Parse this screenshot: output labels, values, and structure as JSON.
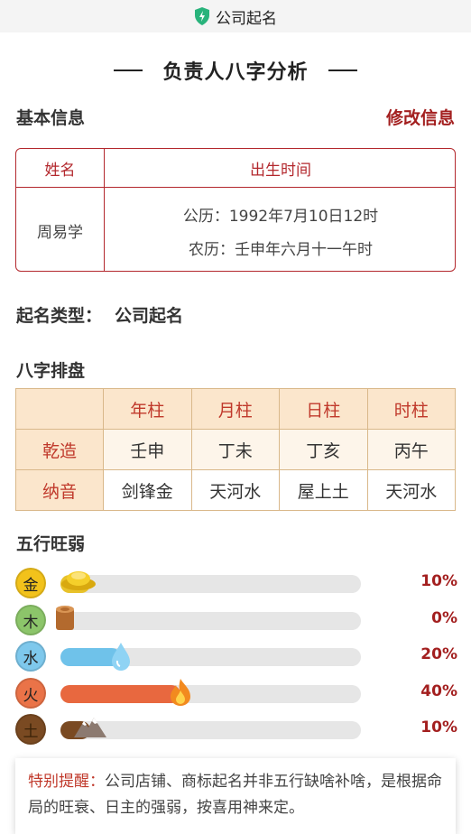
{
  "topbar": {
    "title": "公司起名",
    "icon": "shield-bolt-icon",
    "accent": "#28b37b"
  },
  "page": {
    "title": "负责人八字分析"
  },
  "basic_info": {
    "section_title": "基本信息",
    "edit_label": "修改信息",
    "headers": {
      "name": "姓名",
      "birth": "出生时间"
    },
    "name": "周易学",
    "solar": "公历：1992年7月10日12时",
    "lunar": "农历：壬申年六月十一午时"
  },
  "naming_type": {
    "label": "起名类型：",
    "value": "公司起名"
  },
  "bazi": {
    "section_title": "八字排盘",
    "columns": [
      "年柱",
      "月柱",
      "日柱",
      "时柱"
    ],
    "rows": [
      {
        "label": "乾造",
        "values": [
          "壬申",
          "丁未",
          "丁亥",
          "丙午"
        ]
      },
      {
        "label": "纳音",
        "values": [
          "剑锋金",
          "天河水",
          "屋上土",
          "天河水"
        ]
      }
    ]
  },
  "wuxing": {
    "section_title": "五行旺弱",
    "items": [
      {
        "element": "金",
        "percent": "10%",
        "value": 10,
        "badge_color": "#f2c21b",
        "bar_color": "#e8c22a",
        "icon": "gold-ingot-icon"
      },
      {
        "element": "木",
        "percent": "0%",
        "value": 0,
        "badge_color": "#8cc56a",
        "bar_color": "#b36a2e",
        "icon": "wood-log-icon"
      },
      {
        "element": "水",
        "percent": "20%",
        "value": 20,
        "badge_color": "#7ec8ec",
        "bar_color": "#6fc2ea",
        "icon": "water-drop-icon"
      },
      {
        "element": "火",
        "percent": "40%",
        "value": 40,
        "badge_color": "#ea7348",
        "bar_color": "#e8683f",
        "icon": "flame-icon"
      },
      {
        "element": "土",
        "percent": "10%",
        "value": 10,
        "badge_color": "#7a4a22",
        "bar_color": "#7a4a22",
        "icon": "mountain-icon"
      }
    ]
  },
  "notice": {
    "label": "特别提醒：",
    "text": "公司店铺、商标起名并非五行缺啥补啥，是根据命局的旺衰、日主的强弱，按喜用神来定。"
  }
}
